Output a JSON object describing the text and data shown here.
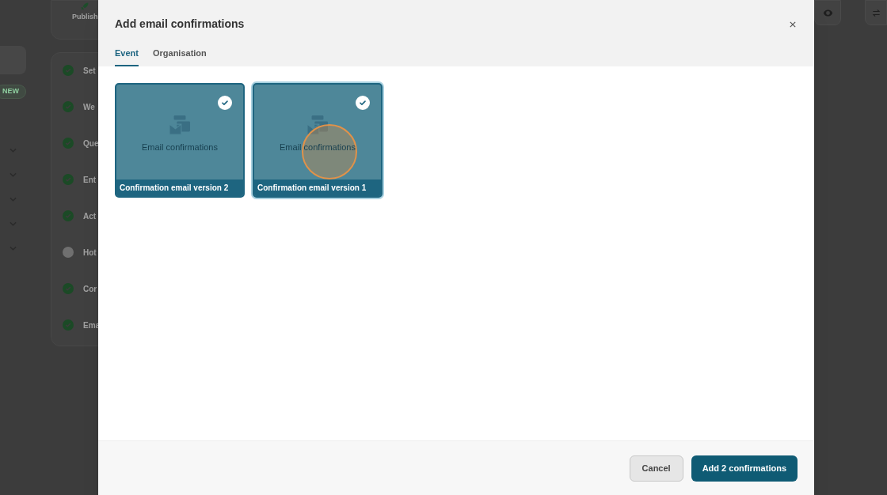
{
  "background": {
    "publish_label": "Publish",
    "badge": "NEW",
    "sidebar_rows": [
      {
        "expanded": false
      },
      {
        "expanded": false
      },
      {
        "expanded": false
      },
      {
        "expanded": false
      },
      {
        "expanded": false
      }
    ],
    "steps": [
      {
        "label": "Set",
        "completed": true
      },
      {
        "label": "We",
        "completed": true
      },
      {
        "label": "Que",
        "completed": true
      },
      {
        "label": "Ent",
        "completed": true
      },
      {
        "label": "Act",
        "completed": true
      },
      {
        "label": "Hot",
        "completed": false
      },
      {
        "label": "Cor",
        "completed": true
      },
      {
        "label": "Ema",
        "completed": true
      }
    ]
  },
  "dialog": {
    "title": "Add email confirmations",
    "tabs": [
      {
        "label": "Event",
        "selected": true
      },
      {
        "label": "Organisation",
        "selected": false
      }
    ],
    "templates": [
      {
        "title": "Confirmation email version 2",
        "caption": "Email confirmations",
        "selected": true,
        "focused": false,
        "pointer": false
      },
      {
        "title": "Confirmation email version 1",
        "caption": "Email confirmations",
        "selected": true,
        "focused": true,
        "pointer": true
      }
    ],
    "cancel_button": "Cancel",
    "confirm_button": "Add 2 confirmations"
  }
}
